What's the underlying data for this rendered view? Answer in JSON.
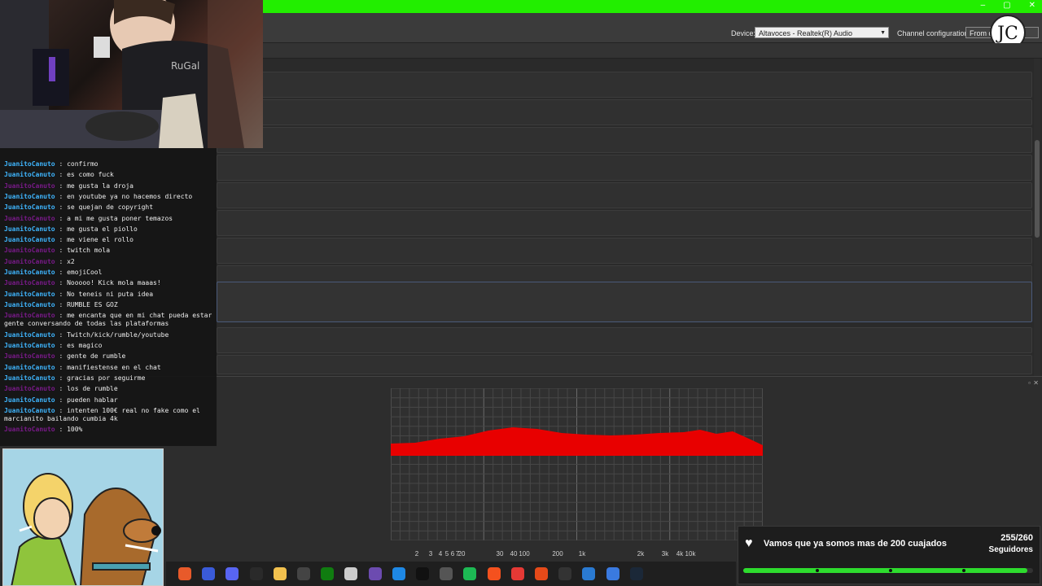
{
  "toolbar": {
    "device_label": "Device:",
    "device_value": "Altavoces - Realtek(R) Audio",
    "channel_label": "Channel configuration:",
    "channel_value": "From d"
  },
  "window_controls": [
    "–",
    "▢",
    "✕"
  ],
  "analysis": {
    "freq_labels": [
      "2",
      "3",
      "4",
      "5",
      "6",
      "7",
      "20",
      "30",
      "40",
      "100",
      "200",
      "1k",
      "2k",
      "3k",
      "4k",
      "10k"
    ],
    "fill_color": "#e80000"
  },
  "chat": {
    "user_color_blue": "#3fb6ff",
    "user_color_purple": "#7a1a8a",
    "messages": [
      {
        "user": "JuanitoCanuto",
        "text": " : confirmo"
      },
      {
        "user": "JuanitoCanuto",
        "text": " : es como fuck"
      },
      {
        "user": "JuanitoCanuto",
        "text": " : me gusta la droja"
      },
      {
        "user": "JuanitoCanuto",
        "text": " : en youtube ya no hacemos directo"
      },
      {
        "user": "JuanitoCanuto",
        "text": " : se quejan de copyright"
      },
      {
        "user": "JuanitoCanuto",
        "text": " : a mi me gusta poner temazos"
      },
      {
        "user": "JuanitoCanuto",
        "text": " : me gusta el piollo"
      },
      {
        "user": "JuanitoCanuto",
        "text": " : me viene el rollo"
      },
      {
        "user": "JuanitoCanuto",
        "text": " : twitch mola"
      },
      {
        "user": "JuanitoCanuto",
        "text": " : x2"
      },
      {
        "user": "JuanitoCanuto",
        "text": " : emojiCool"
      },
      {
        "user": "JuanitoCanuto",
        "text": " : Nooooo! Kick mola maaas!"
      },
      {
        "user": "JuanitoCanuto",
        "text": " : No teneis ni puta idea"
      },
      {
        "user": "JuanitoCanuto",
        "text": " : RUMBLE ES GOZ"
      },
      {
        "user": "JuanitoCanuto",
        "text": " : me encanta que en mi chat pueda estar gente conversando de todas las plataformas"
      },
      {
        "user": "JuanitoCanuto",
        "text": " : Twitch/kick/rumble/youtube"
      },
      {
        "user": "JuanitoCanuto",
        "text": " : es magico"
      },
      {
        "user": "JuanitoCanuto",
        "text": " : gente de rumble"
      },
      {
        "user": "JuanitoCanuto",
        "text": " : manifiestense en el chat"
      },
      {
        "user": "JuanitoCanuto",
        "text": " : gracias por seguirme"
      },
      {
        "user": "JuanitoCanuto",
        "text": " : los de rumble"
      },
      {
        "user": "JuanitoCanuto",
        "text": " : pueden hablar"
      },
      {
        "user": "JuanitoCanuto",
        "text": " : intenten 100€ real no fake como el marcianito bailando cumbia 4k"
      },
      {
        "user": "JuanitoCanuto",
        "text": " : 100%"
      }
    ]
  },
  "goal": {
    "text": "Vamos que ya somos mas de 200 cuajados",
    "count": "255/260",
    "label": "Seguidores",
    "progress": 0.98,
    "bar_color": "#2edc2e"
  },
  "taskbar_icons": [
    "brave-icon",
    "vegas-icon",
    "discord-icon",
    "obs-icon",
    "folder-icon",
    "app-icon",
    "xbox-icon",
    "box-icon",
    "visual-studio-icon",
    "vscode-icon",
    "capcut-icon",
    "unity-icon",
    "spotify-icon",
    "brave-lion-icon",
    "chrome-icon",
    "git-icon",
    "terminal-icon",
    "pen-icon",
    "pen2-icon",
    "steam-icon"
  ]
}
